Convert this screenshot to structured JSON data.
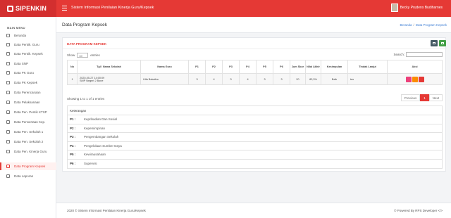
{
  "brand": {
    "name": "SIPENKIN"
  },
  "topbar": {
    "title": "Sistem Informasi Penilaian Kinerja Guru/Kepsek",
    "user_name": "Becky Prudens Budiharnes"
  },
  "sidebar": {
    "header": "MAIN MENU",
    "items": [
      {
        "label": "Beranda"
      },
      {
        "label": "Data Pentik. Guru"
      },
      {
        "label": "Data Pentik. Kepsek"
      },
      {
        "label": "Data SNP"
      },
      {
        "label": "Data PK Guru"
      },
      {
        "label": "Data PK Kepsek"
      },
      {
        "label": "Data Perencanaan"
      },
      {
        "label": "Data Pelaksanaan"
      },
      {
        "label": "Data Pen. Pentik KTSP"
      },
      {
        "label": "Data Pensertaan Kep."
      },
      {
        "label": "Data Pen. Sekolah 1"
      },
      {
        "label": "Data Pen. Sekolah 2"
      },
      {
        "label": "Data Pen. Kinerja Guru"
      },
      {
        "label": "Data Program Kepsek"
      },
      {
        "label": "Data Laporan"
      }
    ]
  },
  "page": {
    "title": "Data Program Kepsek",
    "breadcrumb": [
      "Beranda",
      "Data Program Kepsek"
    ]
  },
  "card": {
    "title": "DATA PROGRAM KEPSEK"
  },
  "controls": {
    "show_label": "Show",
    "show_value": "10",
    "entries_label": "entries",
    "search_label": "Search:"
  },
  "table": {
    "headers": [
      "No",
      "Tgl / Nama Sekolah",
      "Nama Guru",
      "P1",
      "P2",
      "P3",
      "P4",
      "P5",
      "P6",
      "Jum Skor",
      "Nilai Akhir",
      "Kesimpulan",
      "Tindak Lanjut",
      "Aksi"
    ],
    "rows": [
      {
        "no": "1",
        "tgl": "2020-05-27 14:00:09",
        "sekolah": "SMP Negeri 2 Bone",
        "guru": "Ulfa Bakatha",
        "p1": "3",
        "p2": "4",
        "p3": "3",
        "p4": "4",
        "p5": "3",
        "p6": "3",
        "jum": "20",
        "nilai": "83,3%",
        "kesimpulan": "Baik",
        "tindak": "tes"
      }
    ]
  },
  "info": "Showing 1 to 1 of 1 entries",
  "pager": {
    "prev": "Previous",
    "page": "1",
    "next": "Next"
  },
  "keterangan": {
    "title": "Keterangan",
    "items": [
      {
        "k": "P1 :",
        "v": "Kepribadian Dan Sosial"
      },
      {
        "k": "P2 :",
        "v": "Kepemimpinan"
      },
      {
        "k": "P3 :",
        "v": "Pengembangan Sekolah"
      },
      {
        "k": "P4 :",
        "v": "Pengelolaan Sumber Daya"
      },
      {
        "k": "P5 :",
        "v": "Kewirausahaan"
      },
      {
        "k": "P6 :",
        "v": "Supervisi"
      }
    ]
  },
  "footer": {
    "left": "2020 © Sistem Informasi Penilaian Kinerja Guru/Kepsek",
    "right": "© Powered By RPS Developer </>"
  },
  "colors": {
    "accent": "#e53935",
    "accent_dark": "#d32f2f"
  }
}
